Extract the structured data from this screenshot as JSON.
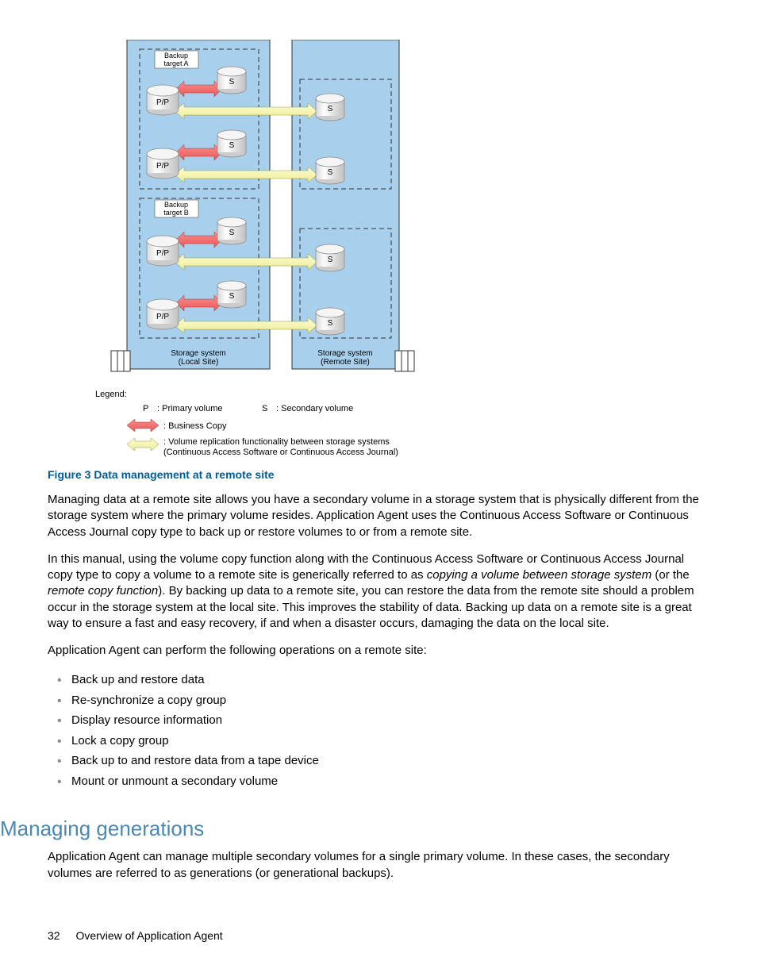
{
  "diagram": {
    "groupA_label": "Backup\ntarget A",
    "groupB_label": "Backup\ntarget B",
    "pp_label": "P/P",
    "s_label": "S",
    "local_caption_line1": "Storage system",
    "local_caption_line2": "(Local Site)",
    "remote_caption_line1": "Storage system",
    "remote_caption_line2": "(Remote Site)",
    "legend_title": "Legend:",
    "legend_p": "P",
    "legend_p_desc": ": Primary volume",
    "legend_s": "S",
    "legend_s_desc": ": Secondary volume",
    "legend_bc": ": Business Copy",
    "legend_repl_line1": ": Volume replication functionality between storage systems",
    "legend_repl_line2": "(Continuous Access Software or Continuous Access Journal)"
  },
  "figure_caption": "Figure 3 Data management at a remote site",
  "para1": "Managing data at a remote site allows you have a secondary volume in a storage system that is physically different from the storage system where the primary volume resides. Application Agent uses the Continuous Access Software or Continuous Access Journal copy type to back up or restore volumes to or from a remote site.",
  "para2_a": "In this manual, using the volume copy function along with the Continuous Access Software or Continuous Access Journal copy type to copy a volume to a remote site is generically referred to as ",
  "para2_i1": "copying a volume between storage system",
  "para2_b": " (or the ",
  "para2_i2": "remote copy function",
  "para2_c": "). By backing up data to a remote site, you can restore the data from the remote site should a problem occur in the storage system at the local site. This improves the stability of data. Backing up data on a remote site is a great way to ensure a fast and easy recovery, if and when a disaster occurs, damaging the data on the local site.",
  "para3": "Application Agent can perform the following operations on a remote site:",
  "ops": [
    "Back up and restore data",
    "Re-synchronize a copy group",
    "Display resource information",
    "Lock a copy group",
    "Back up to and restore data from a tape device",
    "Mount or unmount a secondary volume"
  ],
  "heading": "Managing generations",
  "para4": "Application Agent can manage multiple secondary volumes for a single primary volume. In these cases, the secondary volumes are referred to as generations (or generational backups).",
  "footer_page": "32",
  "footer_title": "Overview of Application Agent"
}
